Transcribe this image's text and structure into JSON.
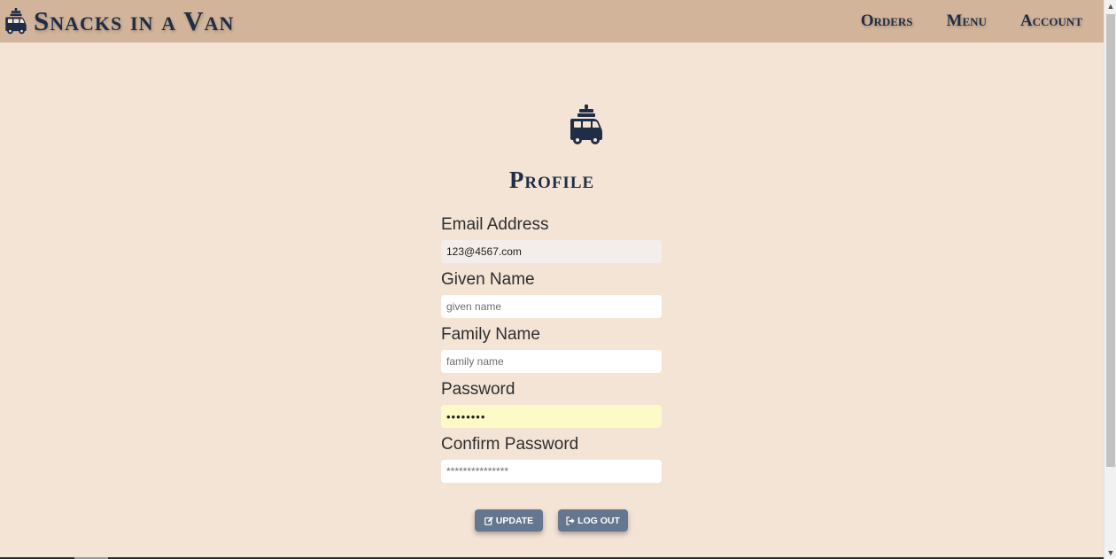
{
  "navbar": {
    "brand": "Snacks in a Van",
    "brand_icon": "van-icon",
    "links": [
      "Orders",
      "Menu",
      "Account"
    ]
  },
  "page": {
    "logo_icon": "van-icon",
    "title": "Profile"
  },
  "form": {
    "email": {
      "label": "Email Address",
      "value": "123@4567.com"
    },
    "given_name": {
      "label": "Given Name",
      "placeholder": "given name"
    },
    "family_name": {
      "label": "Family Name",
      "placeholder": "family name"
    },
    "password": {
      "label": "Password",
      "value": "password"
    },
    "confirm_password": {
      "label": "Confirm Password",
      "placeholder": "***************"
    }
  },
  "buttons": {
    "update": {
      "label": "UPDATE",
      "icon": "edit-icon"
    },
    "logout": {
      "label": "LOG OUT",
      "icon": "sign-out-icon"
    }
  },
  "colors": {
    "navbar": "#d2b49a",
    "background": "#f4e4d6",
    "navy": "#1f2d46",
    "button": "#64778f",
    "autofill": "#fcfac6"
  }
}
